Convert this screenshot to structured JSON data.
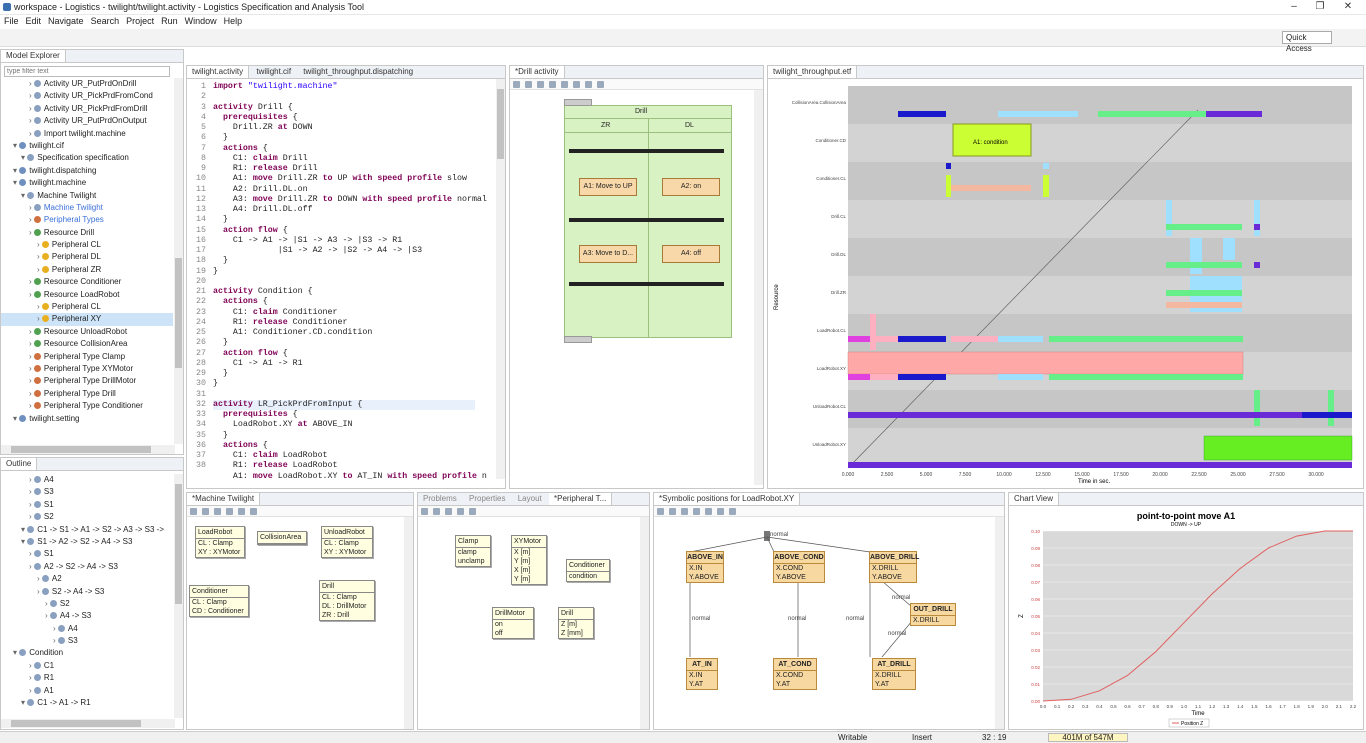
{
  "window": {
    "title": "workspace - Logistics - twilight/twilight.activity - Logistics Specification and Analysis Tool"
  },
  "menu": [
    "File",
    "Edit",
    "Navigate",
    "Search",
    "Project",
    "Run",
    "Window",
    "Help"
  ],
  "quick_access": "Quick Access",
  "model_explorer": {
    "tab": "Model Explorer",
    "filter_placeholder": "type filter text",
    "items": [
      {
        "label": "Activity UR_PutPrdOnDrill",
        "indent": 3
      },
      {
        "label": "Activity UR_PickPrdFromCond",
        "indent": 3
      },
      {
        "label": "Activity UR_PickPrdFromDrill",
        "indent": 3
      },
      {
        "label": "Activity UR_PutPrdOnOutput",
        "indent": 3
      },
      {
        "label": "Import twilight.machine",
        "indent": 3
      },
      {
        "label": "twilight.cif",
        "indent": 1
      },
      {
        "label": "Specification specification",
        "indent": 2
      },
      {
        "label": "twilight.dispatching",
        "indent": 1
      },
      {
        "label": "twilight.machine",
        "indent": 1
      },
      {
        "label": "Machine Twilight",
        "indent": 2
      },
      {
        "label": "Machine Twilight",
        "indent": 3,
        "link": true
      },
      {
        "label": "Peripheral Types",
        "indent": 3,
        "link": true
      },
      {
        "label": "Resource Drill",
        "indent": 3
      },
      {
        "label": "Peripheral CL",
        "indent": 4
      },
      {
        "label": "Peripheral DL",
        "indent": 4
      },
      {
        "label": "Peripheral ZR",
        "indent": 4
      },
      {
        "label": "Resource Conditioner",
        "indent": 3
      },
      {
        "label": "Resource LoadRobot",
        "indent": 3
      },
      {
        "label": "Peripheral CL",
        "indent": 4
      },
      {
        "label": "Peripheral XY",
        "indent": 4,
        "selected": true
      },
      {
        "label": "Resource UnloadRobot",
        "indent": 3
      },
      {
        "label": "Resource CollisionArea",
        "indent": 3
      },
      {
        "label": "Peripheral Type Clamp",
        "indent": 3
      },
      {
        "label": "Peripheral Type XYMotor",
        "indent": 3
      },
      {
        "label": "Peripheral Type DrillMotor",
        "indent": 3
      },
      {
        "label": "Peripheral Type Drill",
        "indent": 3
      },
      {
        "label": "Peripheral Type Conditioner",
        "indent": 3
      },
      {
        "label": "twilight.setting",
        "indent": 1
      }
    ]
  },
  "outline": {
    "tab": "Outline",
    "items": [
      {
        "label": "A4",
        "indent": 3
      },
      {
        "label": "S3",
        "indent": 3
      },
      {
        "label": "S1",
        "indent": 3
      },
      {
        "label": "S2",
        "indent": 3
      },
      {
        "label": "C1 -> S1 -> A1 -> S2 -> A3 -> S3 ->",
        "indent": 2
      },
      {
        "label": "S1 -> A2 -> S2 -> A4 -> S3",
        "indent": 2
      },
      {
        "label": "S1",
        "indent": 3
      },
      {
        "label": "A2 -> S2 -> A4 -> S3",
        "indent": 3
      },
      {
        "label": "A2",
        "indent": 4
      },
      {
        "label": "S2 -> A4 -> S3",
        "indent": 4
      },
      {
        "label": "S2",
        "indent": 5
      },
      {
        "label": "A4 -> S3",
        "indent": 5
      },
      {
        "label": "A4",
        "indent": 6
      },
      {
        "label": "S3",
        "indent": 6
      },
      {
        "label": "Condition",
        "indent": 1
      },
      {
        "label": "C1",
        "indent": 3
      },
      {
        "label": "R1",
        "indent": 3
      },
      {
        "label": "A1",
        "indent": 3
      },
      {
        "label": "C1 -> A1 -> R1",
        "indent": 2
      }
    ]
  },
  "editor": {
    "tabs": [
      "twilight.activity",
      "twilight.cif",
      "twilight_throughput.dispatching"
    ],
    "lines": [
      "import \"twilight.machine\"",
      "",
      "activity Drill {",
      "  prerequisites {",
      "    Drill.ZR at DOWN",
      "  }",
      "  actions {",
      "    C1: claim Drill",
      "    R1: release Drill",
      "    A1: move Drill.ZR to UP with speed profile slow",
      "    A2: Drill.DL.on",
      "    A3: move Drill.ZR to DOWN with speed profile normal",
      "    A4: Drill.DL.off",
      "  }",
      "  action flow {",
      "    C1 -> A1 -> |S1 -> A3 -> |S3 -> R1",
      "             |S1 -> A2 -> |S2 -> A4 -> |S3",
      "  }",
      "}",
      "",
      "activity Condition {",
      "  actions {",
      "    C1: claim Conditioner",
      "    R1: release Conditioner",
      "    A1: Conditioner.CD.condition",
      "  }",
      "  action flow {",
      "    C1 -> A1 -> R1",
      "  }",
      "}",
      "",
      "activity LR_PickPrdFromInput {",
      "  prerequisites {",
      "    LoadRobot.XY at ABOVE_IN",
      "  }",
      "  actions {",
      "    C1: claim LoadRobot",
      "    R1: release LoadRobot",
      "    A1: move LoadRobot.XY to AT_IN with speed profile no"
    ],
    "line_numbers": [
      "1",
      "2",
      "3",
      "4",
      "5",
      "6",
      "7",
      "8",
      "9",
      "10",
      "11",
      "12",
      "13",
      "14",
      "15",
      "16",
      "17",
      "18",
      "19",
      "20",
      "21",
      "22",
      "23",
      "24",
      "25",
      "26",
      "27",
      "28",
      "29",
      "30",
      "31",
      "32",
      "33",
      "34",
      "35",
      "36",
      "37",
      "38"
    ],
    "current_line": 32
  },
  "drill_activity": {
    "tab": "*Drill activity",
    "title": "Drill",
    "zr": "ZR",
    "dl": "DL",
    "a1": "A1: Move to UP",
    "a2": "A2: on",
    "a3": "A3: Move to D...",
    "a4": "A4: off"
  },
  "gantt": {
    "tab": "twilight_throughput.etf",
    "ylabel": "Resource",
    "xlabel": "Time in sec.",
    "resources": [
      "CollisionArea.CollisionArea",
      "Conditioner.CD",
      "Conditioner.CL",
      "Drill.CL",
      "Drill.DL",
      "Drill.ZR",
      "LoadRobot.CL",
      "LoadRobot.XY",
      "UnloadRobot.CL",
      "UnloadRobot.XY"
    ],
    "xticks": [
      "0.000",
      "2.500",
      "5.000",
      "7.500",
      "10.000",
      "12.500",
      "15.000",
      "17.500",
      "20.000",
      "22.500",
      "25.000",
      "27.500",
      "30.000"
    ],
    "label_box": "A1: condition"
  },
  "machine_twilight": {
    "tab": "*Machine Twilight",
    "load_robot": {
      "title": "LoadRobot",
      "rows": [
        "CL : Clamp",
        "XY : XYMotor"
      ]
    },
    "collision": {
      "title": "CollisionArea"
    },
    "unload_robot": {
      "title": "UnloadRobot",
      "rows": [
        "CL : Clamp",
        "XY : XYMotor"
      ]
    },
    "conditioner": {
      "title": "Conditioner",
      "rows": [
        "CL : Clamp",
        "CD : Conditioner"
      ]
    },
    "drill": {
      "title": "Drill",
      "rows": [
        "CL : Clamp",
        "DL : DrillMotor",
        "ZR : Drill"
      ]
    }
  },
  "peripheral_tab": {
    "tabs": [
      "Problems",
      "Properties",
      "Layout",
      "*Peripheral T..."
    ],
    "clamp": {
      "title": "Clamp",
      "rows": [
        "clamp",
        "unclamp"
      ]
    },
    "xymotor": {
      "title": "XYMotor",
      "rows": [
        "X [m]",
        "Y [m]",
        "X [m]",
        "Y [m]"
      ]
    },
    "conditioner": {
      "title": "Conditioner",
      "rows": [
        "condition"
      ]
    },
    "drillmotor": {
      "title": "DrillMotor",
      "rows": [
        "on",
        "off"
      ]
    },
    "drill": {
      "title": "Drill",
      "rows": [
        "Z [m]",
        "Z [mm]"
      ]
    }
  },
  "symbolic": {
    "tab": "*Symbolic positions for LoadRobot.XY",
    "boxes": [
      {
        "title": "ABOVE_IN",
        "rows": [
          "X.IN",
          "Y.ABOVE"
        ]
      },
      {
        "title": "ABOVE_COND",
        "rows": [
          "X.COND",
          "Y.ABOVE"
        ]
      },
      {
        "title": "ABOVE_DRILL",
        "rows": [
          "X.DRILL",
          "Y.ABOVE"
        ]
      },
      {
        "title": "OUT_DRILL",
        "rows": [
          "X.DRILL"
        ]
      },
      {
        "title": "AT_IN",
        "rows": [
          "X.IN",
          "Y.AT"
        ]
      },
      {
        "title": "AT_COND",
        "rows": [
          "X.COND",
          "Y.AT"
        ]
      },
      {
        "title": "AT_DRILL",
        "rows": [
          "X.DRILL",
          "Y.AT"
        ]
      }
    ],
    "edge_label": "normal"
  },
  "chart_view": {
    "tab": "Chart View",
    "title": "point-to-point move A1",
    "subtitle": "DOWN -> UP",
    "xlabel": "Time",
    "ylabel": "Z",
    "legend": "Position Z"
  },
  "chart_data": {
    "type": "line",
    "title": "point-to-point move A1",
    "subtitle": "DOWN -> UP",
    "xlabel": "Time",
    "ylabel": "Z",
    "xlim": [
      0.0,
      2.2
    ],
    "ylim": [
      0.0,
      0.1
    ],
    "xticks": [
      "0.0",
      "0.1",
      "0.2",
      "0.3",
      "0.4",
      "0.5",
      "0.6",
      "0.7",
      "0.8",
      "0.9",
      "1.0",
      "1.1",
      "1.2",
      "1.3",
      "1.4",
      "1.5",
      "1.6",
      "1.7",
      "1.8",
      "1.9",
      "2.0",
      "2.1",
      "2.2"
    ],
    "yticks": [
      "0.00",
      "0.01",
      "0.02",
      "0.03",
      "0.04",
      "0.05",
      "0.06",
      "0.07",
      "0.08",
      "0.09",
      "0.10"
    ],
    "series": [
      {
        "name": "Position Z",
        "color": "#e06060",
        "x": [
          0.0,
          0.2,
          0.4,
          0.6,
          0.8,
          1.0,
          1.2,
          1.4,
          1.6,
          1.8,
          2.0,
          2.1,
          2.2
        ],
        "y": [
          0.0,
          0.001,
          0.006,
          0.015,
          0.029,
          0.046,
          0.063,
          0.078,
          0.09,
          0.097,
          0.1,
          0.1,
          0.1
        ]
      }
    ]
  },
  "status": {
    "writable": "Writable",
    "insert": "Insert",
    "position": "32 : 19",
    "memory": "401M of 547M"
  }
}
